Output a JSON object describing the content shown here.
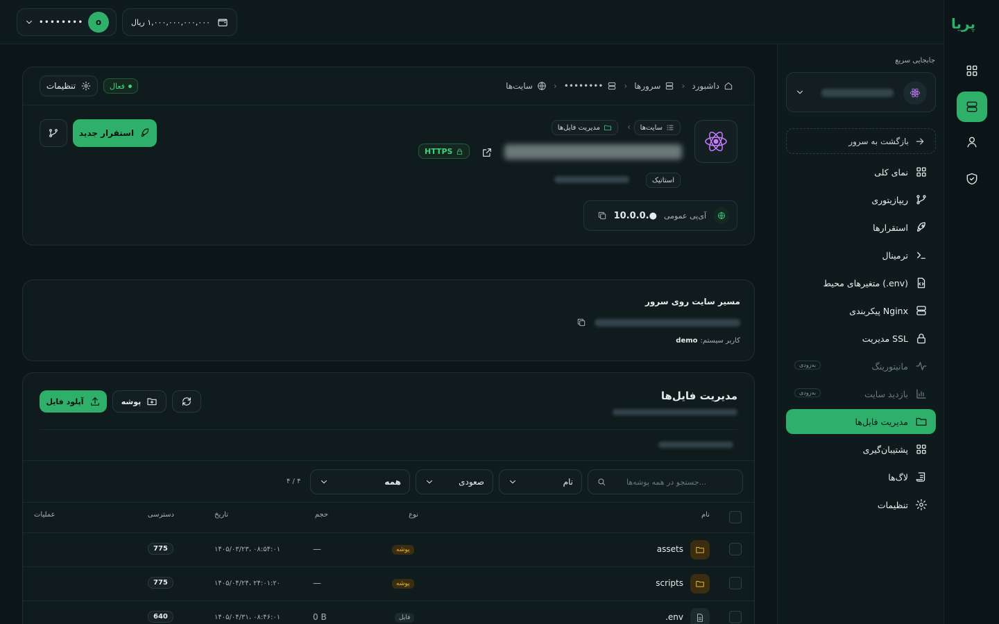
{
  "topbar": {
    "user_masked": "••••••••",
    "avatar_initial": "o",
    "wallet_balance": "۱,۰۰۰,۰۰۰,۰۰۰,۰۰۰ ریال"
  },
  "rail": {
    "logo": "پریا"
  },
  "sidenav": {
    "quick_switch_title": "جابجایی سریع",
    "back_to_server": "بازگشت به سرور",
    "items": [
      {
        "label": "نمای کلی",
        "icon": "grid-icon"
      },
      {
        "label": "ریپازیتوری",
        "icon": "git-branch-icon"
      },
      {
        "label": "استقرارها",
        "icon": "rocket-icon"
      },
      {
        "label": "ترمینال",
        "icon": "terminal-icon"
      },
      {
        "label": "متغیرهای محیط (.env)",
        "icon": "env-file-icon"
      },
      {
        "label": "پیکربندی Nginx",
        "icon": "server-icon"
      },
      {
        "label": "مدیریت SSL",
        "icon": "lock-icon"
      },
      {
        "label": "مانیتورینگ",
        "icon": "activity-icon",
        "badge": "به‌زودی"
      },
      {
        "label": "بازدید سایت",
        "icon": "bar-chart-icon",
        "badge": "به‌زودی"
      },
      {
        "label": "مدیریت فایل‌ها",
        "icon": "folder-icon"
      },
      {
        "label": "پشتیبان‌گیری",
        "icon": "backup-icon"
      },
      {
        "label": "لاگ‌ها",
        "icon": "logs-icon"
      },
      {
        "label": "تنظیمات",
        "icon": "gear-icon"
      }
    ]
  },
  "header": {
    "breadcrumb": [
      "داشبورد",
      "سرورها",
      "••••••••",
      "سایت‌ها"
    ],
    "status": "فعال",
    "settings_label": "تنظیمات",
    "deploy_label": "استقرار جدید",
    "site_chips": [
      "سایت‌ها",
      "مدیریت فایل‌ها"
    ],
    "https_label": "HTTPS",
    "site_type": "استاتیک",
    "public_ip_label": "آی‌پی عمومی",
    "public_ip": "10.0.0.●"
  },
  "path_card": {
    "title": "مسیر سایت روی سرور",
    "system_user_label": "کاربر سیستم:",
    "system_user": "demo"
  },
  "files": {
    "title": "مدیریت فایل‌ها",
    "upload_label": "آپلود فایل",
    "folder_label": "پوشه",
    "search_placeholder": "جستجو در همه پوشه‌ها...",
    "sort_field": "نام",
    "sort_order": "صعودی",
    "filter": "همه",
    "count": "۴ / ۴",
    "columns": {
      "name": "نام",
      "type": "نوع",
      "size": "حجم",
      "date": "تاریخ",
      "perm": "دسترسی",
      "actions": "عملیات"
    },
    "rows": [
      {
        "name": "assets",
        "kind": "folder",
        "type": "پوشه",
        "size": "—",
        "date": "۱۴۰۵/۰۳/۲۳، ۰۸:۵۴:۰۱",
        "perm": "775"
      },
      {
        "name": "scripts",
        "kind": "folder",
        "type": "پوشه",
        "size": "—",
        "date": "۱۴۰۵/۰۴/۲۴، ۲۴:۰۱:۲۰",
        "perm": "775"
      },
      {
        "name": ".env",
        "kind": "file",
        "type": "فایل",
        "size": "0 B",
        "date": "۱۴۰۵/۰۴/۳۱، ۰۸:۴۶:۰۱",
        "perm": "640"
      }
    ]
  }
}
